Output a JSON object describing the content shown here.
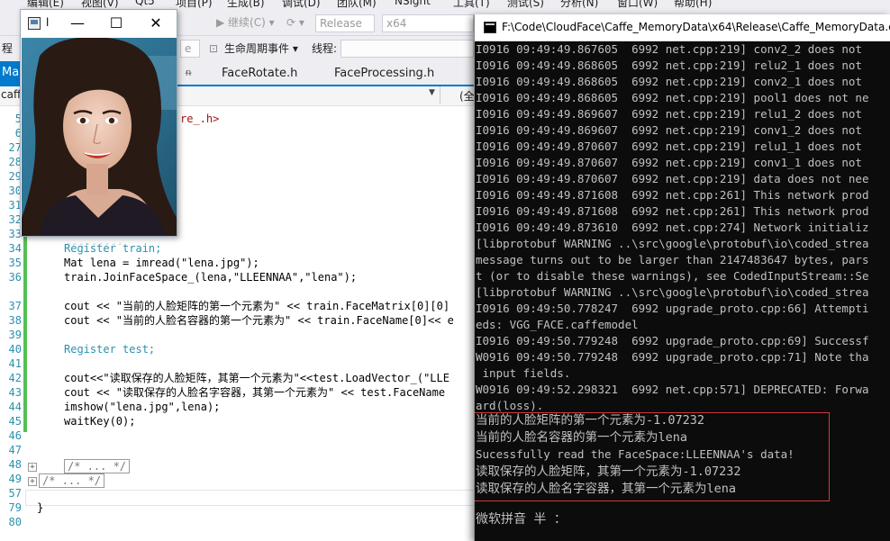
{
  "ide": {
    "menu": [
      "编辑(E)",
      "视图(V)",
      "Qt5",
      "项目(P)",
      "生成(B)",
      "调试(D)",
      "团队(M)",
      "NSight",
      "工具(T)",
      "测试(S)",
      "分析(N)",
      "窗口(W)",
      "帮助(H)"
    ],
    "toolbar": {
      "continue_label": "▶ 继续(C) ▾",
      "config": "Release",
      "platform": "x64"
    },
    "navbar": {
      "process_label": "程",
      "thread_combo": "e",
      "lifecycle_label": "生命周期事件 ▾",
      "thread_label": "线程:"
    },
    "tabs": {
      "active": "Mai",
      "pin": "ᵰ",
      "tab1": "FaceRotate.h",
      "tab2": "FaceProcessing.h"
    },
    "scope": {
      "left": "caffe",
      "right": "(全"
    },
    "editor": {
      "line_numbers": [
        "5",
        "6",
        "27",
        "28",
        "29",
        "30",
        "31",
        "32",
        "33",
        "34",
        "35",
        "36",
        "37",
        "38",
        "39",
        "40",
        "41",
        "42",
        "43",
        "44",
        "45",
        "46",
        "47",
        "48",
        "49",
        "57",
        "79",
        "80"
      ],
      "line_5_tail": "re_.h>",
      "line_34": "Register train;",
      "line_35": "Mat lena = imread(\"lena.jpg\");",
      "line_36": "train.JoinFaceSpace_(lena,\"LLEENNAA\",\"lena\");",
      "line_37": "cout << \"当前的人脸矩阵的第一个元素为\" << train.FaceMatrix[0][0]",
      "line_38": "cout << \"当前的人脸名容器的第一个元素为\" << train.FaceName[0]<< e",
      "line_40": "Register test;",
      "line_42": "cout<<\"读取保存的人脸矩阵，其第一个元素为\"<<test.LoadVector_(\"LLE",
      "line_43": "cout << \"读取保存的人脸名字容器，其第一个元素为\" << test.FaceName",
      "line_44": "imshow(\"lena.jpg\",lena);",
      "line_45": "waitKey(0);",
      "line_48": "/* ... */",
      "line_49": "/* ... */",
      "line_80": "}"
    }
  },
  "image_window": {
    "title": "l",
    "min": "—",
    "max": "☐",
    "close": "✕"
  },
  "console": {
    "title": "F:\\Code\\CloudFace\\Caffe_MemoryData\\x64\\Release\\Caffe_MemoryData.exe",
    "lines": [
      "I0916 09:49:49.867605  6992 net.cpp:219] conv2_2 does not",
      "I0916 09:49:49.868605  6992 net.cpp:219] relu2_1 does not",
      "I0916 09:49:49.868605  6992 net.cpp:219] conv2_1 does not",
      "I0916 09:49:49.868605  6992 net.cpp:219] pool1 does not ne",
      "I0916 09:49:49.869607  6992 net.cpp:219] relu1_2 does not",
      "I0916 09:49:49.869607  6992 net.cpp:219] conv1_2 does not",
      "I0916 09:49:49.870607  6992 net.cpp:219] relu1_1 does not",
      "I0916 09:49:49.870607  6992 net.cpp:219] conv1_1 does not",
      "I0916 09:49:49.870607  6992 net.cpp:219] data does not nee",
      "I0916 09:49:49.871608  6992 net.cpp:261] This network prod",
      "I0916 09:49:49.871608  6992 net.cpp:261] This network prod",
      "I0916 09:49:49.873610  6992 net.cpp:274] Network initializ",
      "[libprotobuf WARNING ..\\src\\google\\protobuf\\io\\coded_strea",
      "message turns out to be larger than 2147483647 bytes, pars",
      "t (or to disable these warnings), see CodedInputStream::Se",
      "[libprotobuf WARNING ..\\src\\google\\protobuf\\io\\coded_strea",
      "I0916 09:49:50.778247  6992 upgrade_proto.cpp:66] Attempti",
      "eds: VGG_FACE.caffemodel",
      "I0916 09:49:50.779248  6992 upgrade_proto.cpp:69] Successf",
      "W0916 09:49:50.779248  6992 upgrade_proto.cpp:71] Note tha",
      " input fields.",
      "W0916 09:49:52.298321  6992 net.cpp:571] DEPRECATED: Forwa",
      "ard(loss)."
    ],
    "results": [
      "当前的人脸矩阵的第一个元素为-1.07232",
      "当前的人脸名容器的第一个元素为lena",
      "Sucessfully read the FaceSpace:LLEENNAA's data!",
      "读取保存的人脸矩阵，其第一个元素为-1.07232",
      "读取保存的人脸名字容器，其第一个元素为lena"
    ],
    "ime": "微软拼音 半 ："
  }
}
